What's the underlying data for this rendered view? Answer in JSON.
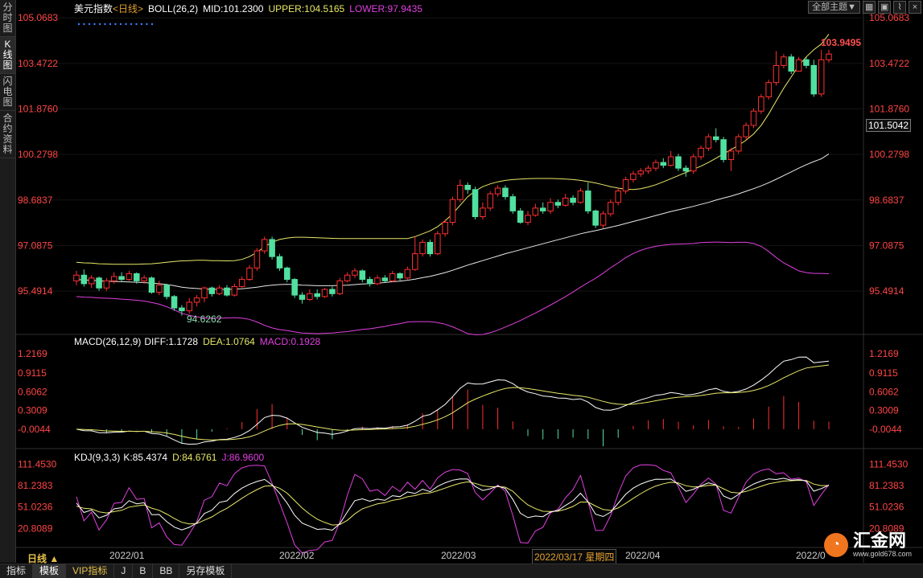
{
  "sidebar": {
    "tabs": [
      "分时图",
      "K线图",
      "闪电图",
      "合约资料"
    ],
    "active": 1
  },
  "toolbar": {
    "theme_label": "全部主题▼",
    "icons": [
      "grid-icon",
      "image-icon",
      "line-icon",
      "close-icon"
    ]
  },
  "main_header": {
    "name": "美元指数",
    "period": "<日线>",
    "boll": "BOLL(26,2)",
    "mid": "MID:101.2300",
    "upper": "UPPER:104.5165",
    "lower": "LOWER:97.9435"
  },
  "macd_header": {
    "label": "MACD(26,12,9)",
    "diff": "DIFF:1.1728",
    "dea": "DEA:1.0764",
    "macd": "MACD:0.1928"
  },
  "kdj_header": {
    "label": "KDJ(9,3,3)",
    "k": "K:85.4374",
    "d": "D:84.6761",
    "j": "J:86.9600"
  },
  "annotations": {
    "high": "103.9495",
    "low": "94.6262",
    "last_price": "101.5042"
  },
  "bottom_bar": {
    "period_label": "日线 ▲",
    "tabs": [
      "指标",
      "模板",
      "VIP指标",
      "J",
      "B",
      "BB",
      "另存模板"
    ],
    "active": 1,
    "dates": [
      "2022/01",
      "2022/02",
      "2022/03",
      "2022/03/17 星期四",
      "2022/04",
      "2022/0"
    ]
  },
  "colors": {
    "up": "#ff3030",
    "down": "#50e0a0",
    "mid": "#e8e8e8",
    "upper": "#e8e868",
    "lower": "#e040e0",
    "diff": "#ffffff",
    "dea": "#e8e868",
    "k": "#ffffff",
    "d": "#e8e868",
    "j": "#e040e0"
  },
  "chart_data": [
    {
      "type": "candlestick",
      "title": "美元指数",
      "yticks": [
        "105.0683",
        "103.4722",
        "101.8760",
        "100.2798",
        "98.6837",
        "97.0875",
        "95.4914"
      ],
      "ylim": [
        94.0,
        105.3
      ],
      "candles": [
        [
          95.85,
          96.05,
          96.2,
          95.7
        ],
        [
          96.05,
          95.75,
          96.25,
          95.65
        ],
        [
          95.75,
          95.95,
          96.05,
          95.6
        ],
        [
          95.95,
          95.6,
          96.0,
          95.5
        ],
        [
          95.6,
          95.85,
          95.95,
          95.5
        ],
        [
          95.85,
          96.0,
          96.15,
          95.75
        ],
        [
          96.0,
          95.9,
          96.15,
          95.8
        ],
        [
          95.9,
          96.1,
          96.2,
          95.85
        ],
        [
          96.1,
          95.85,
          96.15,
          95.75
        ],
        [
          95.85,
          95.95,
          96.05,
          95.75
        ],
        [
          95.95,
          95.45,
          96.0,
          95.4
        ],
        [
          95.45,
          95.7,
          95.85,
          95.35
        ],
        [
          95.7,
          95.3,
          95.75,
          95.2
        ],
        [
          95.3,
          94.9,
          95.35,
          94.8
        ],
        [
          94.9,
          94.8,
          95.0,
          94.63
        ],
        [
          94.8,
          95.1,
          95.25,
          94.7
        ],
        [
          95.1,
          95.25,
          95.35,
          94.95
        ],
        [
          95.25,
          95.6,
          95.65,
          95.1
        ],
        [
          95.6,
          95.4,
          95.65,
          95.3
        ],
        [
          95.4,
          95.6,
          95.7,
          95.35
        ],
        [
          95.6,
          95.35,
          95.7,
          95.3
        ],
        [
          95.35,
          95.65,
          95.75,
          95.3
        ],
        [
          95.65,
          95.9,
          96.0,
          95.6
        ],
        [
          95.9,
          96.3,
          96.4,
          95.85
        ],
        [
          96.3,
          96.9,
          97.0,
          96.2
        ],
        [
          96.9,
          97.3,
          97.4,
          96.8
        ],
        [
          97.3,
          96.7,
          97.4,
          96.6
        ],
        [
          96.7,
          96.3,
          96.8,
          96.2
        ],
        [
          96.3,
          95.9,
          96.35,
          95.8
        ],
        [
          95.9,
          95.35,
          95.95,
          95.25
        ],
        [
          95.35,
          95.2,
          95.45,
          95.05
        ],
        [
          95.2,
          95.4,
          95.55,
          95.15
        ],
        [
          95.4,
          95.3,
          95.55,
          95.2
        ],
        [
          95.3,
          95.55,
          95.6,
          95.25
        ],
        [
          95.55,
          95.4,
          95.65,
          95.3
        ],
        [
          95.4,
          95.85,
          95.95,
          95.35
        ],
        [
          95.85,
          96.05,
          96.15,
          95.8
        ],
        [
          96.05,
          96.2,
          96.3,
          95.95
        ],
        [
          96.2,
          95.9,
          96.25,
          95.8
        ],
        [
          95.9,
          95.75,
          96.0,
          95.65
        ],
        [
          95.75,
          95.95,
          96.05,
          95.7
        ],
        [
          95.95,
          95.85,
          96.05,
          95.8
        ],
        [
          95.85,
          96.1,
          96.2,
          95.8
        ],
        [
          96.1,
          95.95,
          96.15,
          95.85
        ],
        [
          95.95,
          96.25,
          96.35,
          95.9
        ],
        [
          96.25,
          96.8,
          97.4,
          96.2
        ],
        [
          96.8,
          97.2,
          97.3,
          96.7
        ],
        [
          97.2,
          96.8,
          97.3,
          96.7
        ],
        [
          96.8,
          97.5,
          97.6,
          96.75
        ],
        [
          97.5,
          97.9,
          98.0,
          97.4
        ],
        [
          97.9,
          98.7,
          98.8,
          97.8
        ],
        [
          98.7,
          99.2,
          99.4,
          98.6
        ],
        [
          99.2,
          99.05,
          99.3,
          98.9
        ],
        [
          99.05,
          98.1,
          99.15,
          98.0
        ],
        [
          98.1,
          98.4,
          98.6,
          98.0
        ],
        [
          98.4,
          98.9,
          99.0,
          98.3
        ],
        [
          98.9,
          99.1,
          99.2,
          98.8
        ],
        [
          99.1,
          98.8,
          99.2,
          98.7
        ],
        [
          98.8,
          98.3,
          98.9,
          98.2
        ],
        [
          98.3,
          97.9,
          98.4,
          97.85
        ],
        [
          97.9,
          98.15,
          98.3,
          97.8
        ],
        [
          98.15,
          98.4,
          98.55,
          98.1
        ],
        [
          98.4,
          98.3,
          98.6,
          98.2
        ],
        [
          98.3,
          98.6,
          98.75,
          98.2
        ],
        [
          98.6,
          98.5,
          98.7,
          98.4
        ],
        [
          98.5,
          98.75,
          98.9,
          98.45
        ],
        [
          98.75,
          98.6,
          98.85,
          98.5
        ],
        [
          98.6,
          99.0,
          99.1,
          98.55
        ],
        [
          99.0,
          98.3,
          99.3,
          98.2
        ],
        [
          98.3,
          97.8,
          98.35,
          97.7
        ],
        [
          97.8,
          98.2,
          98.3,
          97.7
        ],
        [
          98.2,
          98.6,
          98.7,
          98.1
        ],
        [
          98.6,
          99.0,
          99.1,
          98.5
        ],
        [
          99.0,
          99.4,
          99.5,
          98.9
        ],
        [
          99.4,
          99.6,
          99.7,
          99.3
        ],
        [
          99.6,
          99.7,
          99.8,
          99.5
        ],
        [
          99.7,
          99.8,
          99.9,
          99.6
        ],
        [
          99.8,
          100.0,
          100.1,
          99.7
        ],
        [
          100.0,
          99.9,
          100.15,
          99.8
        ],
        [
          99.9,
          100.2,
          100.4,
          99.85
        ],
        [
          100.2,
          99.8,
          100.3,
          99.7
        ],
        [
          99.8,
          99.7,
          99.9,
          99.5
        ],
        [
          99.7,
          100.2,
          100.3,
          99.6
        ],
        [
          100.2,
          100.5,
          100.6,
          100.1
        ],
        [
          100.5,
          100.9,
          101.0,
          100.4
        ],
        [
          100.9,
          100.8,
          101.2,
          100.7
        ],
        [
          100.8,
          100.1,
          100.9,
          100.0
        ],
        [
          100.1,
          100.4,
          100.5,
          99.7
        ],
        [
          100.4,
          100.9,
          101.0,
          100.3
        ],
        [
          100.9,
          101.3,
          101.4,
          100.8
        ],
        [
          101.3,
          101.8,
          101.9,
          101.2
        ],
        [
          101.8,
          102.3,
          102.4,
          101.7
        ],
        [
          102.3,
          102.8,
          102.9,
          102.2
        ],
        [
          102.8,
          103.4,
          103.9,
          102.7
        ],
        [
          103.4,
          103.7,
          103.8,
          103.3
        ],
        [
          103.7,
          103.2,
          103.8,
          103.1
        ],
        [
          103.2,
          103.6,
          103.7,
          103.2
        ],
        [
          103.6,
          103.4,
          103.7,
          103.3
        ],
        [
          103.4,
          102.4,
          103.6,
          102.3
        ],
        [
          102.4,
          103.6,
          103.95,
          102.3
        ],
        [
          103.6,
          103.8,
          103.95,
          103.5
        ]
      ],
      "boll_mid": [
        95.9,
        95.88,
        95.87,
        95.85,
        95.84,
        95.83,
        95.82,
        95.81,
        95.8,
        95.79,
        95.77,
        95.75,
        95.72,
        95.68,
        95.63,
        95.6,
        95.58,
        95.56,
        95.55,
        95.55,
        95.55,
        95.56,
        95.57,
        95.6,
        95.63,
        95.67,
        95.7,
        95.72,
        95.73,
        95.72,
        95.7,
        95.69,
        95.68,
        95.68,
        95.68,
        95.69,
        95.7,
        95.72,
        95.74,
        95.75,
        95.77,
        95.79,
        95.82,
        95.84,
        95.87,
        95.91,
        95.96,
        96.01,
        96.07,
        96.14,
        96.22,
        96.31,
        96.4,
        96.48,
        96.56,
        96.64,
        96.72,
        96.8,
        96.87,
        96.94,
        97.01,
        97.08,
        97.15,
        97.22,
        97.29,
        97.36,
        97.43,
        97.5,
        97.56,
        97.61,
        97.67,
        97.73,
        97.79,
        97.86,
        97.93,
        98.0,
        98.07,
        98.14,
        98.21,
        98.28,
        98.34,
        98.4,
        98.46,
        98.53,
        98.6,
        98.68,
        98.75,
        98.82,
        98.9,
        98.99,
        99.08,
        99.18,
        99.29,
        99.41,
        99.54,
        99.67,
        99.8,
        99.92,
        100.03,
        100.13,
        100.3
      ],
      "boll_upper": [
        96.5,
        96.48,
        96.47,
        96.45,
        96.44,
        96.43,
        96.43,
        96.43,
        96.43,
        96.44,
        96.45,
        96.47,
        96.5,
        96.53,
        96.55,
        96.56,
        96.57,
        96.57,
        96.56,
        96.56,
        96.55,
        96.56,
        96.6,
        96.7,
        96.85,
        97.05,
        97.2,
        97.3,
        97.35,
        97.38,
        97.38,
        97.37,
        97.36,
        97.35,
        97.34,
        97.33,
        97.33,
        97.33,
        97.33,
        97.33,
        97.33,
        97.33,
        97.33,
        97.33,
        97.33,
        97.4,
        97.5,
        97.6,
        97.75,
        97.95,
        98.2,
        98.5,
        98.8,
        99.0,
        99.15,
        99.25,
        99.32,
        99.37,
        99.4,
        99.42,
        99.43,
        99.44,
        99.44,
        99.44,
        99.43,
        99.42,
        99.4,
        99.37,
        99.33,
        99.28,
        99.22,
        99.15,
        99.1,
        99.06,
        99.05,
        99.08,
        99.14,
        99.22,
        99.32,
        99.43,
        99.54,
        99.65,
        99.76,
        99.87,
        100.0,
        100.15,
        100.3,
        100.45,
        100.6,
        100.78,
        101.0,
        101.3,
        101.7,
        102.15,
        102.6,
        103.0,
        103.4,
        103.7,
        103.95,
        104.15,
        104.5
      ]
    },
    {
      "type": "macd",
      "yticks": [
        "1.2169",
        "0.9115",
        "0.6062",
        "0.3009",
        "-0.0044"
      ],
      "ylim": [
        -0.3,
        1.35
      ]
    },
    {
      "type": "kdj",
      "yticks": [
        "111.4530",
        "81.2383",
        "51.0236",
        "20.8089"
      ],
      "ylim": [
        -5,
        120
      ]
    }
  ]
}
